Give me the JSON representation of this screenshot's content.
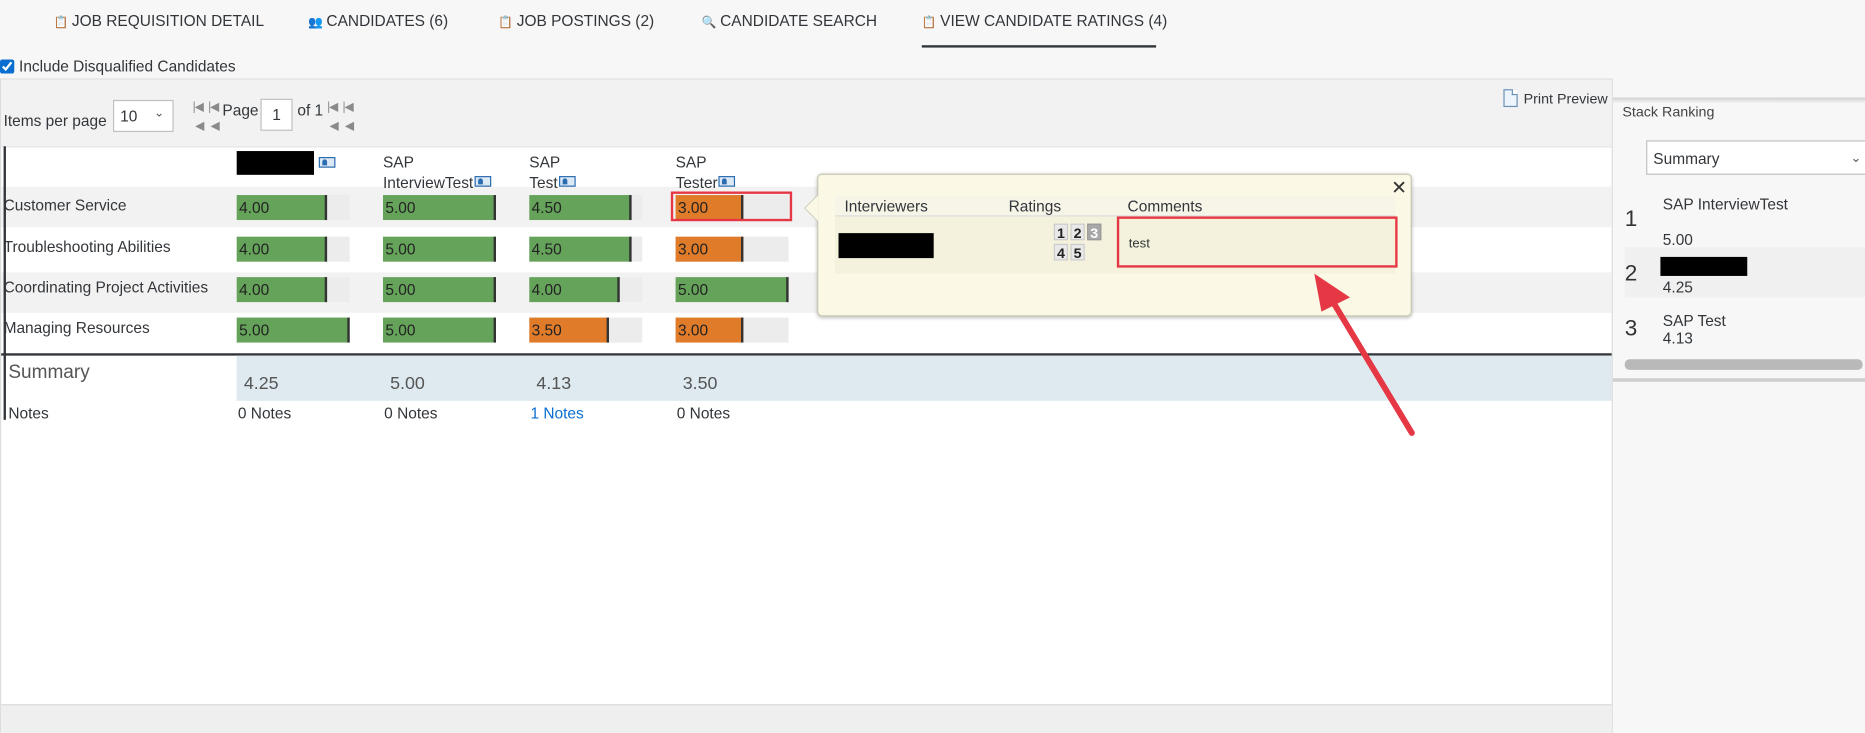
{
  "tabs": [
    {
      "icon": "clipboard-icon",
      "label": "JOB REQUISITION DETAIL"
    },
    {
      "icon": "people-icon",
      "label": "CANDIDATES (6)"
    },
    {
      "icon": "clipboard-icon",
      "label": "JOB POSTINGS (2)"
    },
    {
      "icon": "search-icon",
      "label": "CANDIDATE SEARCH"
    },
    {
      "icon": "clipboard-icon",
      "label": "VIEW CANDIDATE RATINGS (4)",
      "active": true
    }
  ],
  "include_disqualified": {
    "label": "Include Disqualified Candidates",
    "checked": true
  },
  "pager": {
    "items_per_page_label": "Items per page",
    "items_per_page": "10",
    "page_label": "Page",
    "page": "1",
    "of_label": "of 1",
    "print_preview": "Print Preview"
  },
  "candidates": [
    {
      "name": "",
      "redacted": true,
      "summary": "4.25",
      "notes": "0 Notes"
    },
    {
      "name": "SAP InterviewTest",
      "summary": "5.00",
      "notes": "0 Notes"
    },
    {
      "name": "SAP Test",
      "summary": "4.13",
      "notes": "1 Notes"
    },
    {
      "name": "SAP Tester",
      "summary": "3.50",
      "notes": "0 Notes"
    }
  ],
  "criteria": [
    {
      "label": "Customer Service",
      "scores": [
        "4.00",
        "5.00",
        "4.50",
        "3.00"
      ]
    },
    {
      "label": "Troubleshooting Abilities",
      "scores": [
        "4.00",
        "5.00",
        "4.50",
        "3.00"
      ]
    },
    {
      "label": "Coordinating Project Activities",
      "scores": [
        "4.00",
        "5.00",
        "4.00",
        "5.00"
      ]
    },
    {
      "label": "Managing Resources",
      "scores": [
        "5.00",
        "5.00",
        "3.50",
        "3.00"
      ]
    }
  ],
  "rating_max": 5,
  "colors": {
    "high": "#65a35a",
    "low": "#e07b2a",
    "highlight": "#e53844"
  },
  "summary_label": "Summary",
  "notes_label": "Notes",
  "popup": {
    "headers": [
      "Interviewers",
      "Ratings",
      "Comments"
    ],
    "ratings": [
      "1",
      "2",
      "3",
      "4",
      "5"
    ],
    "selected_rating": "3",
    "comment": "test"
  },
  "stack_ranking": {
    "title": "Stack Ranking",
    "dropdown": "Summary",
    "items": [
      {
        "rank": "1",
        "name": "SAP InterviewTest",
        "score": "5.00"
      },
      {
        "rank": "2",
        "name": "",
        "redacted": true,
        "score": "4.25"
      },
      {
        "rank": "3",
        "name": "SAP Test",
        "score": "4.13"
      }
    ]
  }
}
